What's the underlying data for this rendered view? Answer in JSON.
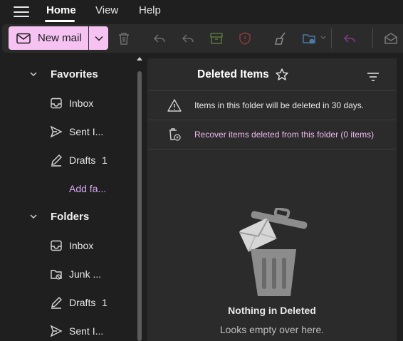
{
  "nav": {
    "tabs": [
      {
        "label": "Home",
        "active": true
      },
      {
        "label": "View",
        "active": false
      },
      {
        "label": "Help",
        "active": false
      }
    ]
  },
  "ribbon": {
    "new_mail_label": "New mail",
    "icons": [
      "trash-icon",
      "reply-icon",
      "reply-all-icon",
      "archive-icon",
      "report-icon",
      "sweep-icon",
      "move-to-icon",
      "undo-icon",
      "envelope-open-icon"
    ]
  },
  "sidebar": {
    "favorites": {
      "label": "Favorites",
      "items": [
        {
          "label": "Inbox",
          "icon": "inbox-icon",
          "count": ""
        },
        {
          "label": "Sent I...",
          "icon": "sent-icon",
          "count": ""
        },
        {
          "label": "Drafts",
          "icon": "drafts-icon",
          "count": "1"
        },
        {
          "label": "Add fa...",
          "icon": "",
          "count": ""
        }
      ]
    },
    "folders": {
      "label": "Folders",
      "items": [
        {
          "label": "Inbox",
          "icon": "inbox-icon",
          "count": ""
        },
        {
          "label": "Junk ...",
          "icon": "junk-icon",
          "count": ""
        },
        {
          "label": "Drafts",
          "icon": "drafts-icon",
          "count": "1"
        },
        {
          "label": "Sent I...",
          "icon": "sent-icon",
          "count": ""
        }
      ]
    }
  },
  "pane": {
    "title": "Deleted Items",
    "notice": "Items in this folder will be deleted in 30 days.",
    "recover": "Recover items deleted from this folder (0 items)",
    "empty_title": "Nothing in Deleted",
    "empty_subtitle": "Looks empty over here."
  },
  "colors": {
    "background": "#1f1f1f",
    "pane": "#2b2b2b",
    "accent": "#f5c2f2",
    "link": "#d9a8f5"
  }
}
